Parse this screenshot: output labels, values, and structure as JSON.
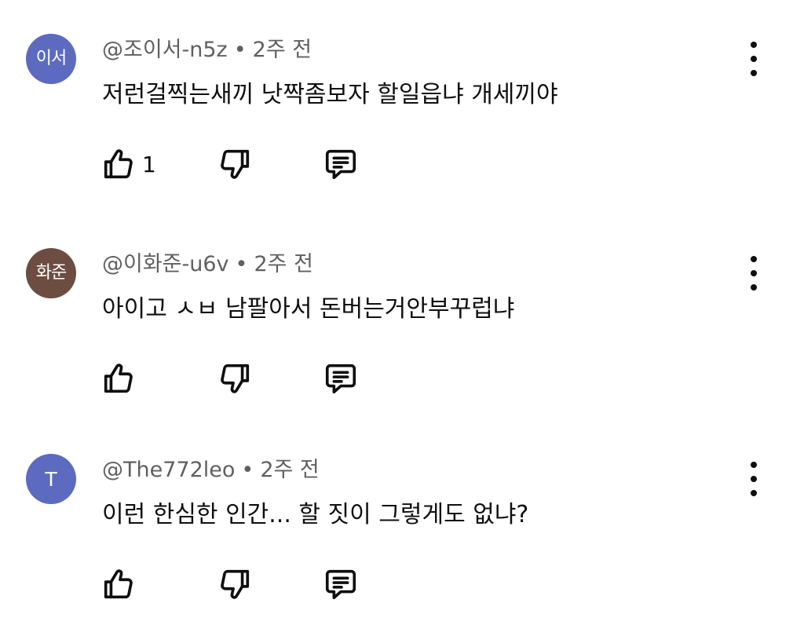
{
  "comments": [
    {
      "avatar_text": "이서",
      "avatar_color": "#5c6bc0",
      "author": "@조이서-n5z",
      "separator": "•",
      "time": "2주 전",
      "text": "저런걸찍는새끼 낫짝좀보자 할일읍냐  개세끼야",
      "likes": "1"
    },
    {
      "avatar_text": "화준",
      "avatar_color": "#6d4c41",
      "author": "@이화준-u6v",
      "separator": "•",
      "time": "2주 전",
      "text": "아이고 ㅅㅂ 남팔아서 돈버는거안부꾸럽냐",
      "likes": ""
    },
    {
      "avatar_text": "T",
      "avatar_color": "#5c6bc0",
      "author": "@The772leo",
      "separator": "•",
      "time": "2주 전",
      "text": "이런 한심한 인간... 할 짓이 그렇게도 없냐?",
      "likes": ""
    }
  ],
  "icons": {
    "like": "thumbs-up-icon",
    "dislike": "thumbs-down-icon",
    "reply": "comment-reply-icon",
    "more": "more-vertical-icon"
  }
}
